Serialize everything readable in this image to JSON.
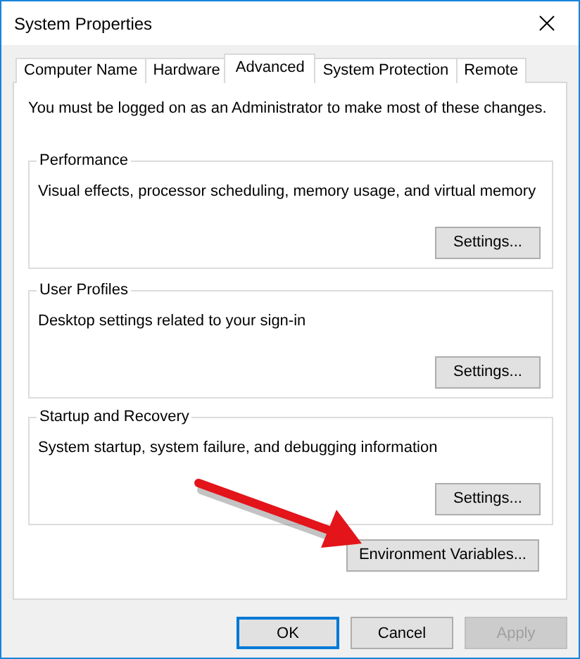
{
  "window": {
    "title": "System Properties"
  },
  "tabs": [
    {
      "label": "Computer Name",
      "selected": false
    },
    {
      "label": "Hardware",
      "selected": false
    },
    {
      "label": "Advanced",
      "selected": true
    },
    {
      "label": "System Protection",
      "selected": false
    },
    {
      "label": "Remote",
      "selected": false
    }
  ],
  "notice": "You must be logged on as an Administrator to make most of these changes.",
  "groups": [
    {
      "title": "Performance",
      "description": "Visual effects, processor scheduling, memory usage, and virtual memory",
      "button": "Settings..."
    },
    {
      "title": "User Profiles",
      "description": "Desktop settings related to your sign-in",
      "button": "Settings..."
    },
    {
      "title": "Startup and Recovery",
      "description": "System startup, system failure, and debugging information",
      "button": "Settings..."
    }
  ],
  "environment_button": "Environment Variables...",
  "buttons": [
    {
      "label": "OK",
      "default": true,
      "disabled": false
    },
    {
      "label": "Cancel",
      "default": false,
      "disabled": false
    },
    {
      "label": "Apply",
      "default": false,
      "disabled": true
    }
  ]
}
